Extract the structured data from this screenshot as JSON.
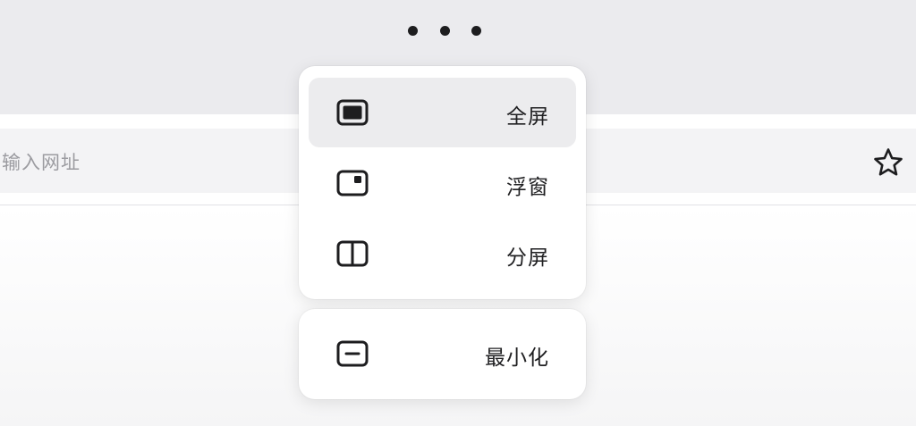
{
  "window_controls": {
    "dots_icon": "more-dots-icon"
  },
  "address_bar": {
    "placeholder": "输入网址",
    "bookmark_icon": "star-icon"
  },
  "window_menu": {
    "groups": [
      {
        "items": [
          {
            "label": "全屏",
            "icon": "fullscreen-icon",
            "active": true
          },
          {
            "label": "浮窗",
            "icon": "floating-window-icon",
            "active": false
          },
          {
            "label": "分屏",
            "icon": "split-screen-icon",
            "active": false
          }
        ]
      },
      {
        "items": [
          {
            "label": "最小化",
            "icon": "minimize-icon",
            "active": false
          }
        ]
      }
    ]
  },
  "colors": {
    "top_bar": "#ebebee",
    "menu_active": "#ececee",
    "text": "#1f1f21",
    "placeholder": "#9b9ba0"
  }
}
